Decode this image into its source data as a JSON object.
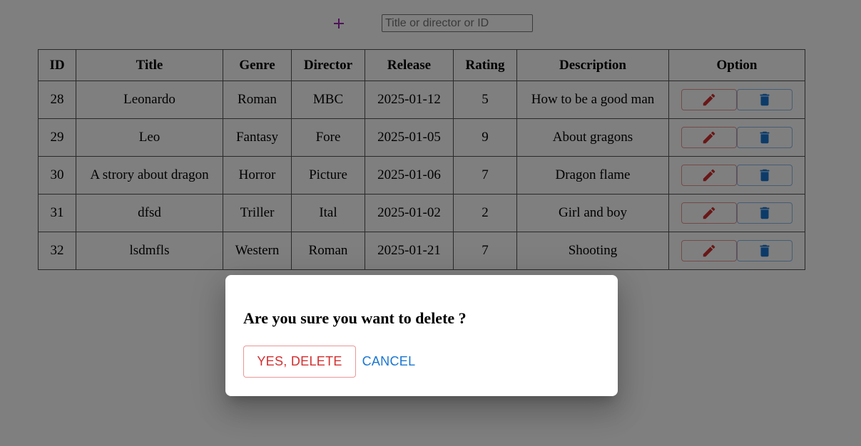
{
  "toolbar": {
    "search_placeholder": "Title or director or ID"
  },
  "table": {
    "headers": [
      "ID",
      "Title",
      "Genre",
      "Director",
      "Release",
      "Rating",
      "Description",
      "Option"
    ],
    "rows": [
      {
        "id": "28",
        "title": "Leonardo",
        "genre": "Roman",
        "director": "MBC",
        "release": "2025-01-12",
        "rating": "5",
        "description": "How to be a good man"
      },
      {
        "id": "29",
        "title": "Leo",
        "genre": "Fantasy",
        "director": "Fore",
        "release": "2025-01-05",
        "rating": "9",
        "description": "About gragons"
      },
      {
        "id": "30",
        "title": "A strory about dragon",
        "genre": "Horror",
        "director": "Picture",
        "release": "2025-01-06",
        "rating": "7",
        "description": "Dragon flame"
      },
      {
        "id": "31",
        "title": "dfsd",
        "genre": "Triller",
        "director": "Ital",
        "release": "2025-01-02",
        "rating": "2",
        "description": "Girl and boy"
      },
      {
        "id": "32",
        "title": "lsdmfls",
        "genre": "Western",
        "director": "Roman",
        "release": "2025-01-21",
        "rating": "7",
        "description": "Shooting"
      }
    ]
  },
  "icons": {
    "add": "plus-icon",
    "edit": "pencil-icon",
    "delete": "trash-icon"
  },
  "colors": {
    "add_icon": "#9c27b0",
    "edit": "#d32f2f",
    "delete": "#1976d2",
    "backdrop": "rgba(0,0,0,0.5)"
  },
  "dialog": {
    "title": "Are you sure you want to delete ?",
    "confirm_label": "YES, DELETE",
    "cancel_label": "CANCEL"
  }
}
